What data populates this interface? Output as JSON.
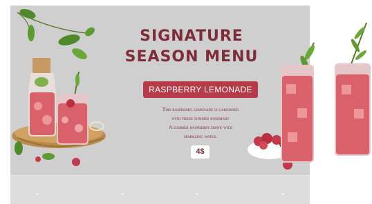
{
  "menu": {
    "title_line1": "SIGNATURE",
    "title_line2": "SEASON MENU",
    "item_name": "RASPBERRY LEMONADE",
    "description": [
      "This raspberry lemonade is garnished",
      "with fresh summer rosemary",
      "A summer raspberry drink with",
      "sparkling water."
    ],
    "price": "4$"
  },
  "colors": {
    "accent": "#b73a48",
    "title": "#7d2d39",
    "board": "#cfcfcf"
  },
  "icons": [
    "leaf-icon",
    "lemonade-bottle-icon",
    "lemonade-glass-icon",
    "serving-tray-icon",
    "raspberry-bowl-icon",
    "rosemary-icon"
  ]
}
